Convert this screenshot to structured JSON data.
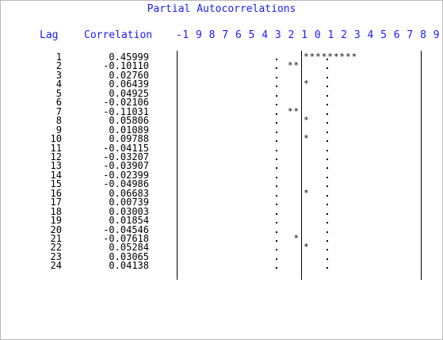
{
  "title": "Partial Autocorrelations",
  "headers": {
    "lag": "Lag",
    "correlation": "Correlation",
    "scale": "-1 9 8 7 6 5 4 3 2 1 0 1 2 3 4 5 6 7 8 9 1"
  },
  "colors": {
    "header": "#1a1aff",
    "text": "#000000",
    "border": "#b8b8b8"
  },
  "chart_data": {
    "type": "bar",
    "title": "Partial Autocorrelations",
    "xlabel": "Lag",
    "ylabel": "Correlation",
    "ylim": [
      -1,
      1
    ],
    "categories": [
      "1",
      "2",
      "3",
      "4",
      "5",
      "6",
      "7",
      "8",
      "9",
      "10",
      "11",
      "12",
      "13",
      "14",
      "15",
      "16",
      "17",
      "18",
      "19",
      "20",
      "21",
      "22",
      "23",
      "24"
    ],
    "values": [
      0.45999,
      -0.1011,
      0.0276,
      0.06439,
      0.04925,
      -0.02106,
      -0.11031,
      0.05806,
      0.01089,
      0.09788,
      -0.04115,
      -0.03207,
      -0.03907,
      -0.02399,
      -0.04986,
      0.06683,
      0.00739,
      0.03003,
      0.01854,
      -0.04546,
      -0.07618,
      0.05284,
      0.03065,
      0.04138
    ],
    "value_labels": [
      "0.45999",
      "-0.10110",
      "0.02760",
      "0.06439",
      "0.04925",
      "-0.02106",
      "-0.11031",
      "0.05806",
      "0.01089",
      "0.09788",
      "-0.04115",
      "-0.03207",
      "-0.03907",
      "-0.02399",
      "-0.04986",
      "0.06683",
      "0.00739",
      "0.03003",
      "0.01854",
      "-0.04546",
      "-0.07618",
      "0.05284",
      "0.03065",
      "0.04138"
    ]
  }
}
